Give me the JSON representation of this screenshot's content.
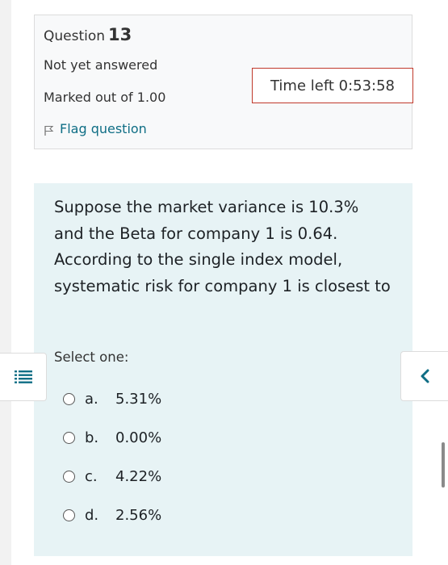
{
  "question_info": {
    "title_prefix": "Question",
    "number": "13",
    "state": "Not yet answered",
    "marks": "Marked out of 1.00",
    "flag_label": "Flag question"
  },
  "timer": {
    "label": "Time left 0:53:58",
    "border_color": "#c0392b"
  },
  "question": {
    "text": "Suppose the market variance is 10.3% and the Beta for company 1 is 0.64. According to the single index model, systematic risk for company 1 is closest to",
    "prompt": "Select one:",
    "options": [
      {
        "letter": "a.",
        "value": "5.31%"
      },
      {
        "letter": "b.",
        "value": "0.00%"
      },
      {
        "letter": "c.",
        "value": "4.22%"
      },
      {
        "letter": "d.",
        "value": "2.56%"
      }
    ]
  },
  "drawer": {
    "icon": "list-icon",
    "color": "#0f6e85"
  },
  "blocks": {
    "icon": "chevron-left-icon",
    "color": "#0f6e85"
  },
  "colors": {
    "accent": "#0f6e85",
    "question_bg": "#e7f3f5",
    "info_bg": "#f8f9fa"
  }
}
